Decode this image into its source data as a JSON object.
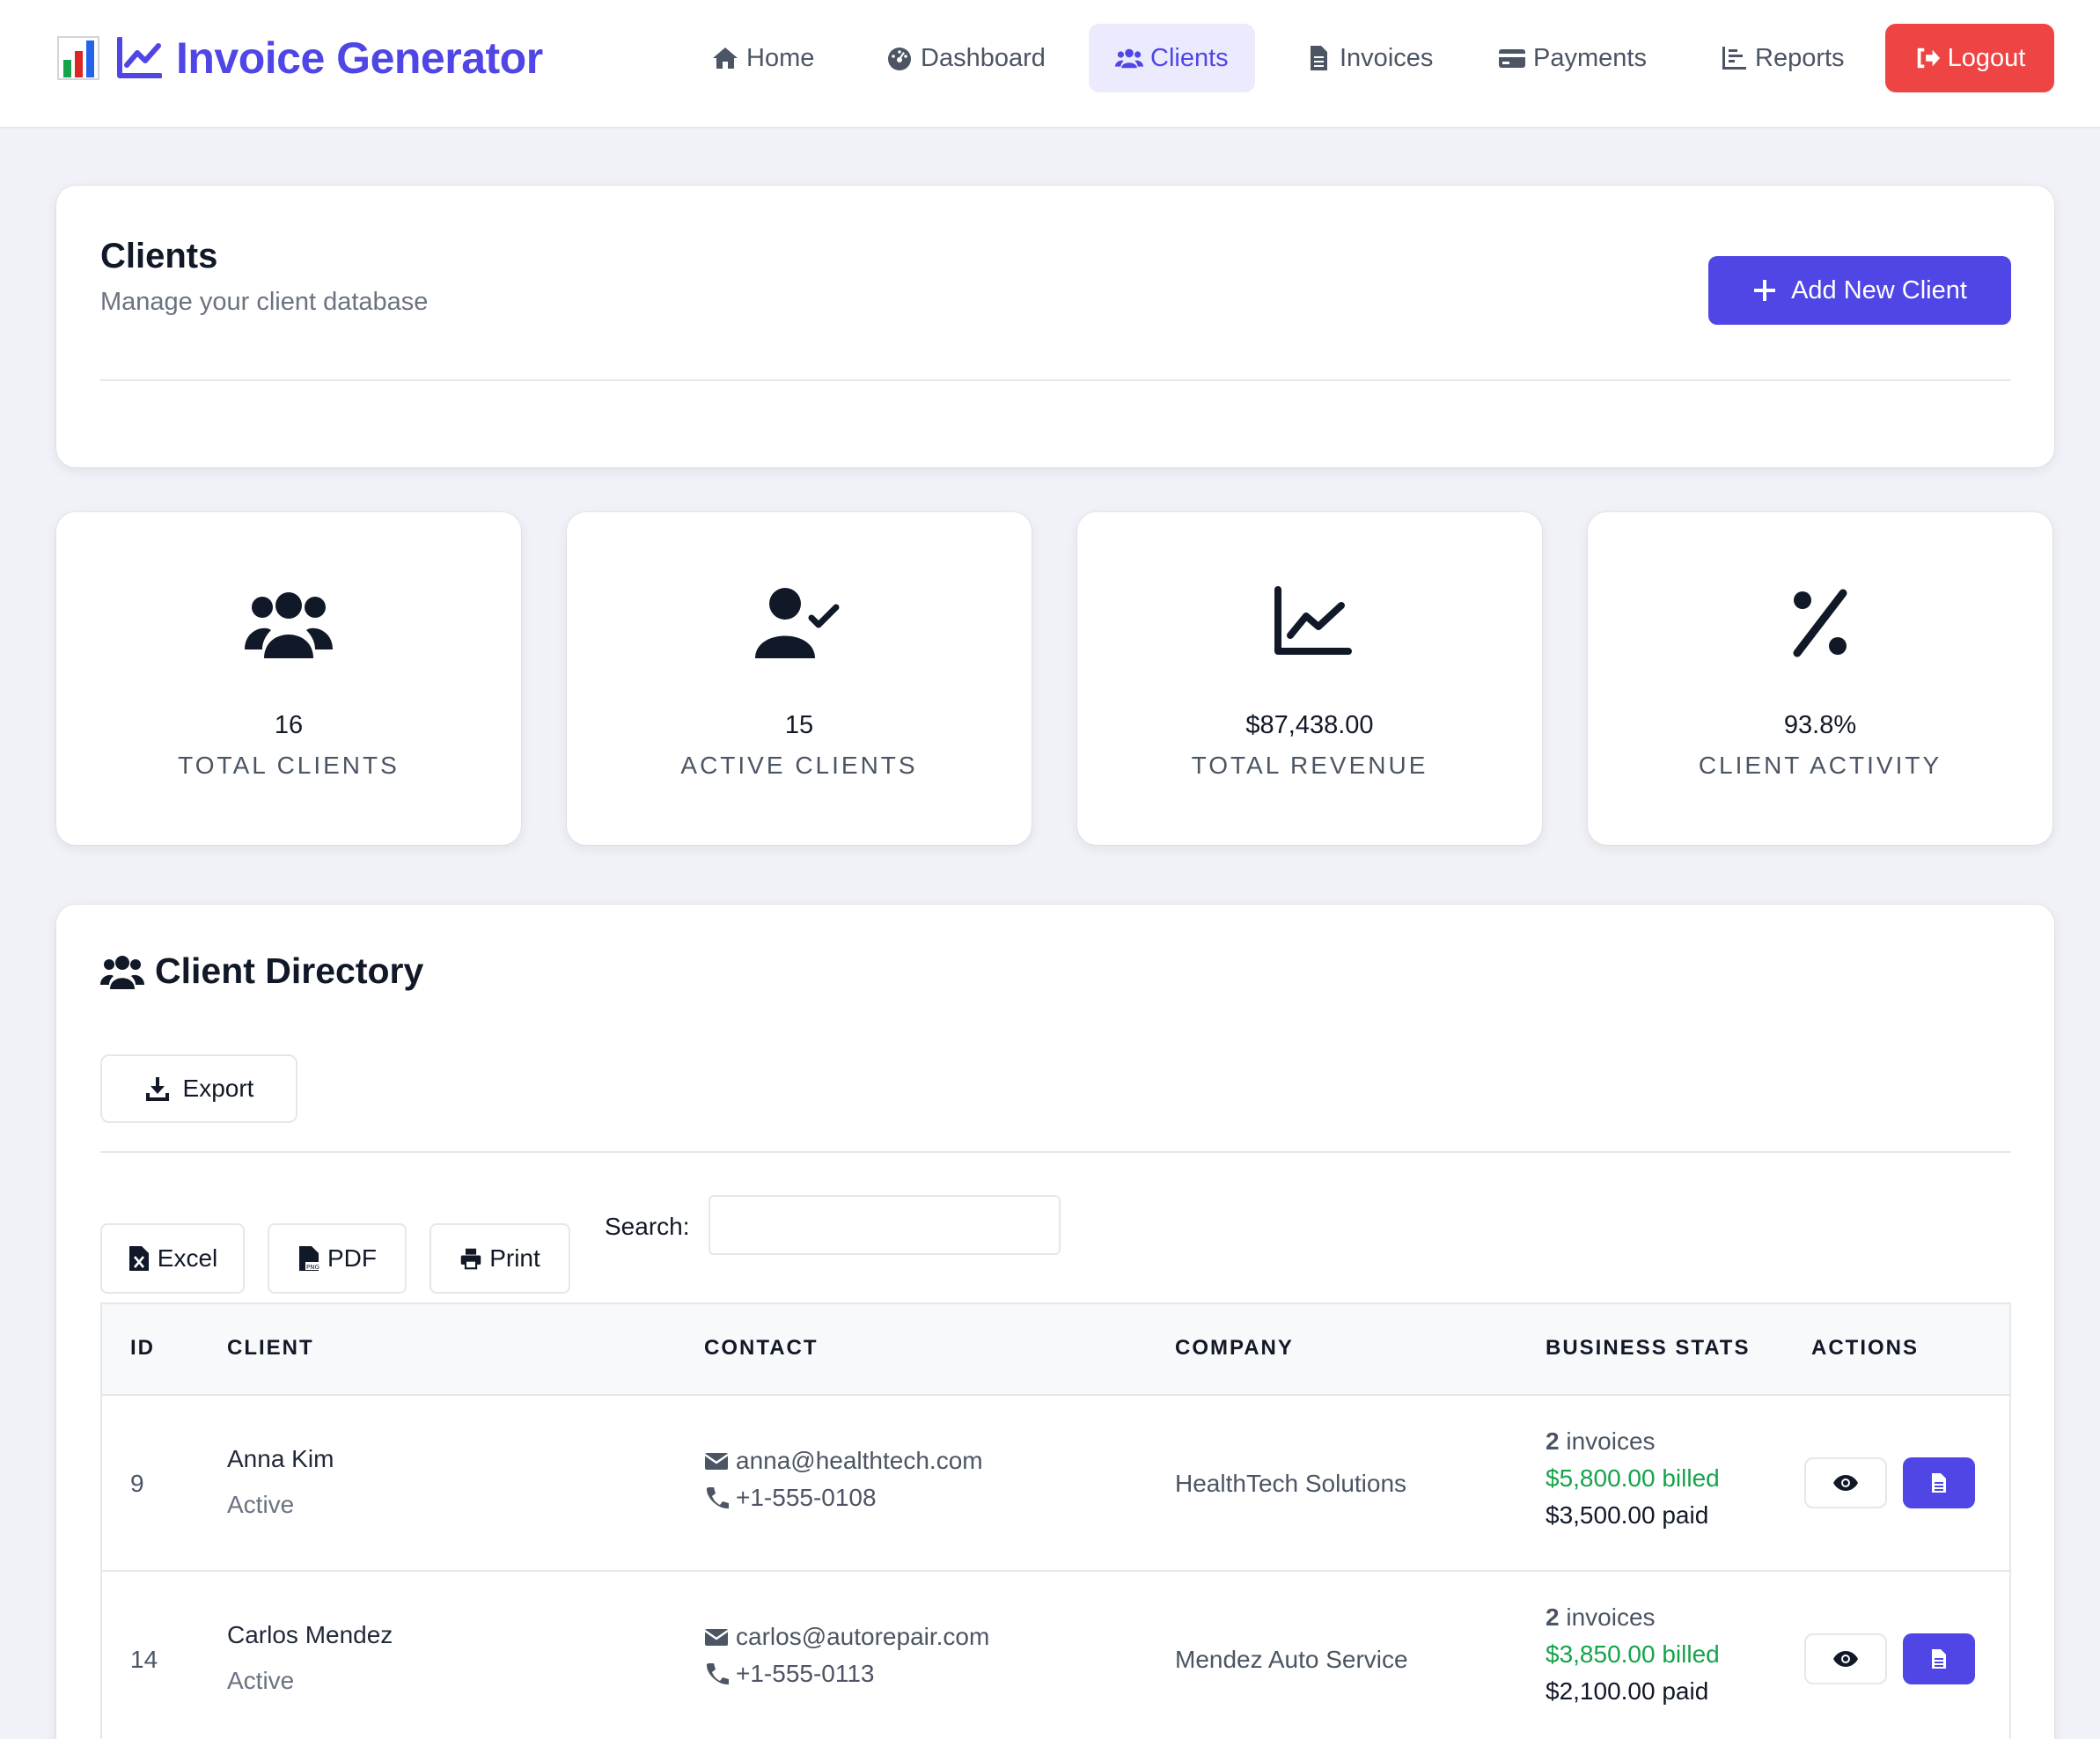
{
  "app": {
    "title": "Invoice Generator",
    "brand_color": "#4f46e5"
  },
  "nav": {
    "items": [
      {
        "label": "Home",
        "icon": "home-icon"
      },
      {
        "label": "Dashboard",
        "icon": "dashboard-icon"
      },
      {
        "label": "Clients",
        "icon": "users-icon",
        "active": true
      },
      {
        "label": "Invoices",
        "icon": "file-icon"
      },
      {
        "label": "Payments",
        "icon": "credit-card-icon"
      },
      {
        "label": "Reports",
        "icon": "bar-chart-icon"
      }
    ],
    "logout_label": "Logout",
    "logout_color": "#ef4444"
  },
  "header": {
    "title": "Clients",
    "subtitle": "Manage your client database",
    "add_button_label": "Add New Client"
  },
  "stats": [
    {
      "value": "16",
      "label": "TOTAL CLIENTS",
      "icon": "users-icon"
    },
    {
      "value": "15",
      "label": "ACTIVE CLIENTS",
      "icon": "user-check-icon"
    },
    {
      "value": "$87,438.00",
      "label": "TOTAL REVENUE",
      "icon": "line-chart-icon"
    },
    {
      "value": "93.8%",
      "label": "CLIENT ACTIVITY",
      "icon": "percent-icon"
    }
  ],
  "directory": {
    "title": "Client Directory",
    "export_label": "Export",
    "tools": {
      "excel_label": "Excel",
      "pdf_label": "PDF",
      "print_label": "Print"
    },
    "search_label": "Search:",
    "search_value": "",
    "columns": [
      "ID",
      "CLIENT",
      "CONTACT",
      "COMPANY",
      "BUSINESS STATS",
      "ACTIONS"
    ],
    "rows": [
      {
        "id": "9",
        "name": "Anna Kim",
        "status": "Active",
        "email": "anna@healthtech.com",
        "phone": "+1-555-0108",
        "company": "HealthTech Solutions",
        "invoices_count": "2",
        "invoices_word": "invoices",
        "billed": "$5,800.00 billed",
        "paid": "$3,500.00 paid"
      },
      {
        "id": "14",
        "name": "Carlos Mendez",
        "status": "Active",
        "email": "carlos@autorepair.com",
        "phone": "+1-555-0113",
        "company": "Mendez Auto Service",
        "invoices_count": "2",
        "invoices_word": "invoices",
        "billed": "$3,850.00 billed",
        "paid": "$2,100.00 paid"
      }
    ]
  },
  "colors": {
    "billed": "#16a34a",
    "accent": "#4f46e5",
    "active_nav_bg": "#ecebfd"
  }
}
